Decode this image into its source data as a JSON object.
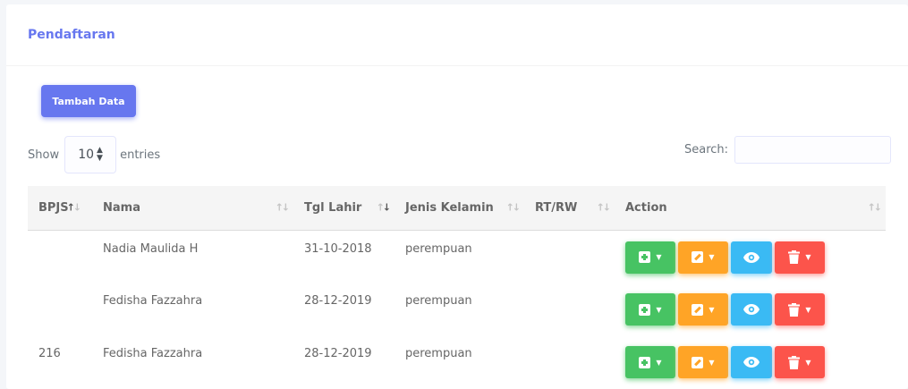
{
  "page": {
    "title": "Pendaftaran",
    "add_button": "Tambah Data"
  },
  "length": {
    "show": "Show",
    "value": "10",
    "entries": "entries"
  },
  "search": {
    "label": "Search:",
    "value": ""
  },
  "table": {
    "columns": [
      "BPJS",
      "Nama",
      "Tgl Lahir",
      "Jenis Kelamin",
      "RT/RW",
      "Action"
    ],
    "rows": [
      {
        "bpjs": "",
        "nama": "Nadia Maulida H",
        "tgl": "31-10-2018",
        "jk": "perempuan",
        "rtrw": ""
      },
      {
        "bpjs": "",
        "nama": "Fedisha Fazzahra",
        "tgl": "28-12-2019",
        "jk": "perempuan",
        "rtrw": ""
      },
      {
        "bpjs": "216",
        "nama": "Fedisha Fazzahra",
        "tgl": "28-12-2019",
        "jk": "perempuan",
        "rtrw": ""
      }
    ],
    "sorted_column": "Tgl Lahir",
    "sort_direction": "descending"
  },
  "icons": {
    "add": "plus-square-icon",
    "edit": "edit-icon",
    "view": "eye-icon",
    "delete": "trash-icon",
    "dropdown": "caret-down-icon"
  },
  "colors": {
    "primary": "#6777ef",
    "success": "#47c363",
    "warning": "#ffa426",
    "info": "#3abaf4",
    "danger": "#fc544b"
  }
}
